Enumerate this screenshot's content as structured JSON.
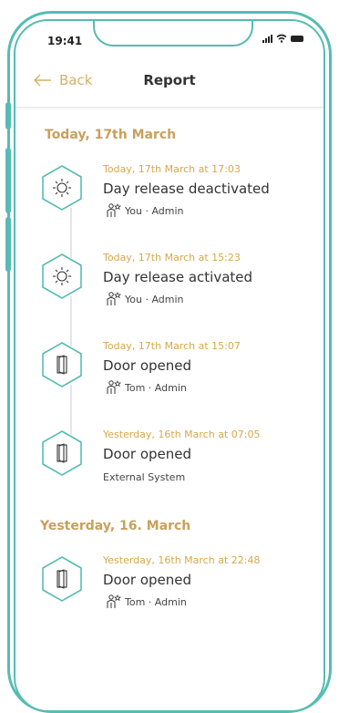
{
  "status": {
    "time": "19:41"
  },
  "header": {
    "back_label": "Back",
    "title": "Report"
  },
  "sections": [
    {
      "title": "Today, 17th March",
      "entries": [
        {
          "date": "Today, 17th March at 17:03",
          "title": "Day release deactivated",
          "meta": "You · Admin",
          "icon": "sun-icon"
        },
        {
          "date": "Today, 17th March at 15:23",
          "title": "Day release activated",
          "meta": "You · Admin",
          "icon": "sun-icon"
        },
        {
          "date": "Today, 17th March at  15:07",
          "title": "Door opened",
          "meta": "Tom · Admin",
          "icon": "door-icon"
        },
        {
          "date": "Yesterday, 16th March at 07:05",
          "title": "Door opened",
          "meta": "External System",
          "icon": "door-icon"
        }
      ]
    },
    {
      "title": "Yesterday, 16. March",
      "entries": [
        {
          "date": "Yesterday, 16th March at 22:48",
          "title": "Door opened",
          "meta": "Tom · Admin",
          "icon": "door-icon"
        }
      ]
    }
  ],
  "colors": {
    "accent_teal": "#56bcb3",
    "accent_gold": "#c9a05b",
    "date_gold": "#d9a74a"
  }
}
